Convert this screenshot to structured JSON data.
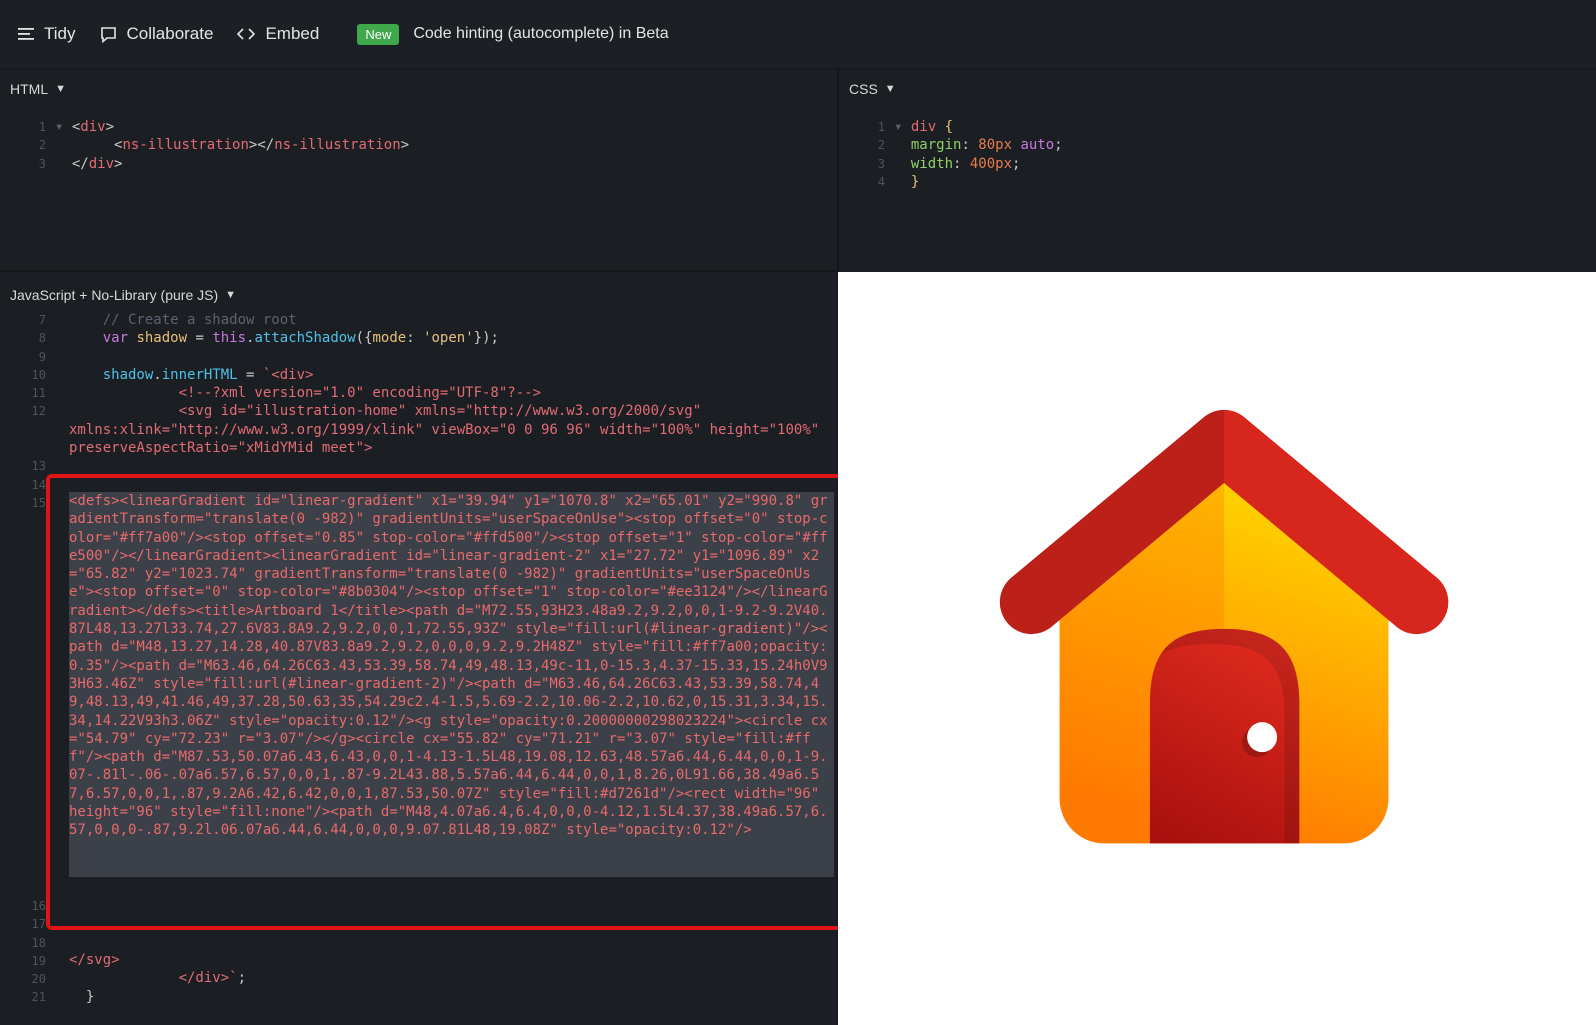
{
  "toolbar": {
    "tidy_label": "Tidy",
    "collaborate_label": "Collaborate",
    "embed_label": "Embed",
    "new_badge": "New",
    "beta_text": "Code hinting (autocomplete) in Beta"
  },
  "html_panel": {
    "title": "HTML",
    "line_numbers": [
      "1",
      "2",
      "3"
    ]
  },
  "css_panel": {
    "title": "CSS",
    "line_numbers": [
      "1",
      "2",
      "3",
      "4"
    ]
  },
  "js_panel": {
    "title": "JavaScript + No-Library (pure JS)",
    "line_numbers": [
      "7",
      "8",
      "9",
      "10",
      "11",
      "12",
      "13",
      "14",
      "15",
      "16",
      "17",
      "18",
      "19",
      "20",
      "21"
    ],
    "selected_code": "<defs><linearGradient id=\"linear-gradient\" x1=\"39.94\" y1=\"1070.8\" x2=\"65.01\" y2=\"990.8\" gradientTransform=\"translate(0 -982)\" gradientUnits=\"userSpaceOnUse\"><stop offset=\"0\" stop-color=\"#ff7a00\"/><stop offset=\"0.85\" stop-color=\"#ffd500\"/><stop offset=\"1\" stop-color=\"#ffe500\"/></linearGradient><linearGradient id=\"linear-gradient-2\" x1=\"27.72\" y1=\"1096.89\" x2=\"65.82\" y2=\"1023.74\" gradientTransform=\"translate(0 -982)\" gradientUnits=\"userSpaceOnUse\"><stop offset=\"0\" stop-color=\"#8b0304\"/><stop offset=\"1\" stop-color=\"#ee3124\"/></linearGradient></defs><title>Artboard 1</title><path d=\"M72.55,93H23.48a9.2,9.2,0,0,1-9.2-9.2V40.87L48,13.27l33.74,27.6V83.8A9.2,9.2,0,0,1,72.55,93Z\" style=\"fill:url(#linear-gradient)\"/><path d=\"M48,13.27,14.28,40.87V83.8a9.2,9.2,0,0,0,9.2,9.2H48Z\" style=\"fill:#ff7a00;opacity:0.35\"/><path d=\"M63.46,64.26C63.43,53.39,58.74,49,48.13,49c-11,0-15.3,4.37-15.33,15.24h0V93H63.46Z\" style=\"fill:url(#linear-gradient-2)\"/><path d=\"M63.46,64.26C63.43,53.39,58.74,49,48.13,49,41.46,49,37.28,50.63,35,54.29c2.4-1.5,5.69-2.2,10.06-2.2,10.62,0,15.31,3.34,15.34,14.22V93h3.06Z\" style=\"opacity:0.12\"/><g style=\"opacity:0.20000000298023224\"><circle cx=\"54.79\" cy=\"72.23\" r=\"3.07\"/></g><circle cx=\"55.82\" cy=\"71.21\" r=\"3.07\" style=\"fill:#fff\"/><path d=\"M87.53,50.07a6.43,6.43,0,0,1-4.13-1.5L48,19.08,12.63,48.57a6.44,6.44,0,0,1-9.07-.81l-.06-.07a6.57,6.57,0,0,1,.87-9.2L43.88,5.57a6.44,6.44,0,0,1,8.26,0L91.66,38.49a6.57,6.57,0,0,1,.87,9.2A6.42,6.42,0,0,1,87.53,50.07Z\" style=\"fill:#d7261d\"/><rect width=\"96\" height=\"96\" style=\"fill:none\"/><path d=\"M48,4.07a6.4,6.4,0,0,0-4.12,1.5L4.37,38.49a6.57,6.57,0,0,0-.87,9.2l.06.07a6.44,6.44,0,0,0,9.07.81L48,19.08Z\" style=\"opacity:0.12\"/>"
  },
  "colors": {
    "accent_new": "#3fa84a",
    "highlight_box": "#e01414",
    "roof": "#d7261d",
    "door": "#ee3124"
  }
}
